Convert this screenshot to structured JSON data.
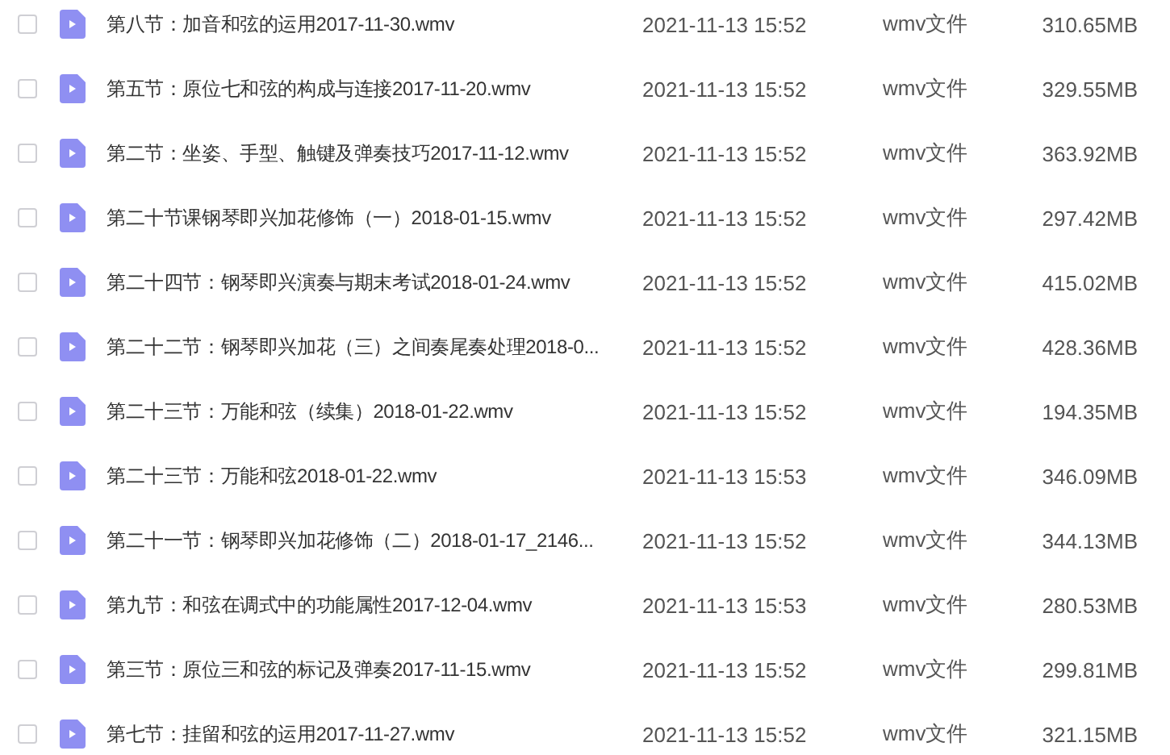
{
  "files": [
    {
      "name": "第八节：加音和弦的运用2017-11-30.wmv",
      "modified": "2021-11-13 15:52",
      "type": "wmv文件",
      "size": "310.65MB",
      "checked": false
    },
    {
      "name": "第五节：原位七和弦的构成与连接2017-11-20.wmv",
      "modified": "2021-11-13 15:52",
      "type": "wmv文件",
      "size": "329.55MB",
      "checked": false
    },
    {
      "name": "第二节：坐姿、手型、触键及弹奏技巧2017-11-12.wmv",
      "modified": "2021-11-13 15:52",
      "type": "wmv文件",
      "size": "363.92MB",
      "checked": false
    },
    {
      "name": "第二十节课钢琴即兴加花修饰（一）2018-01-15.wmv",
      "modified": "2021-11-13 15:52",
      "type": "wmv文件",
      "size": "297.42MB",
      "checked": false
    },
    {
      "name": "第二十四节：钢琴即兴演奏与期末考试2018-01-24.wmv",
      "modified": "2021-11-13 15:52",
      "type": "wmv文件",
      "size": "415.02MB",
      "checked": false
    },
    {
      "name": "第二十二节：钢琴即兴加花（三）之间奏尾奏处理2018-0...",
      "modified": "2021-11-13 15:52",
      "type": "wmv文件",
      "size": "428.36MB",
      "checked": false
    },
    {
      "name": "第二十三节：万能和弦（续集）2018-01-22.wmv",
      "modified": "2021-11-13 15:52",
      "type": "wmv文件",
      "size": "194.35MB",
      "checked": false
    },
    {
      "name": "第二十三节：万能和弦2018-01-22.wmv",
      "modified": "2021-11-13 15:53",
      "type": "wmv文件",
      "size": "346.09MB",
      "checked": false
    },
    {
      "name": "第二十一节：钢琴即兴加花修饰（二）2018-01-17_2146...",
      "modified": "2021-11-13 15:52",
      "type": "wmv文件",
      "size": "344.13MB",
      "checked": false
    },
    {
      "name": "第九节：和弦在调式中的功能属性2017-12-04.wmv",
      "modified": "2021-11-13 15:53",
      "type": "wmv文件",
      "size": "280.53MB",
      "checked": false
    },
    {
      "name": "第三节：原位三和弦的标记及弹奏2017-11-15.wmv",
      "modified": "2021-11-13 15:52",
      "type": "wmv文件",
      "size": "299.81MB",
      "checked": false
    },
    {
      "name": "第七节：挂留和弦的运用2017-11-27.wmv",
      "modified": "2021-11-13 15:52",
      "type": "wmv文件",
      "size": "321.15MB",
      "checked": false
    }
  ]
}
